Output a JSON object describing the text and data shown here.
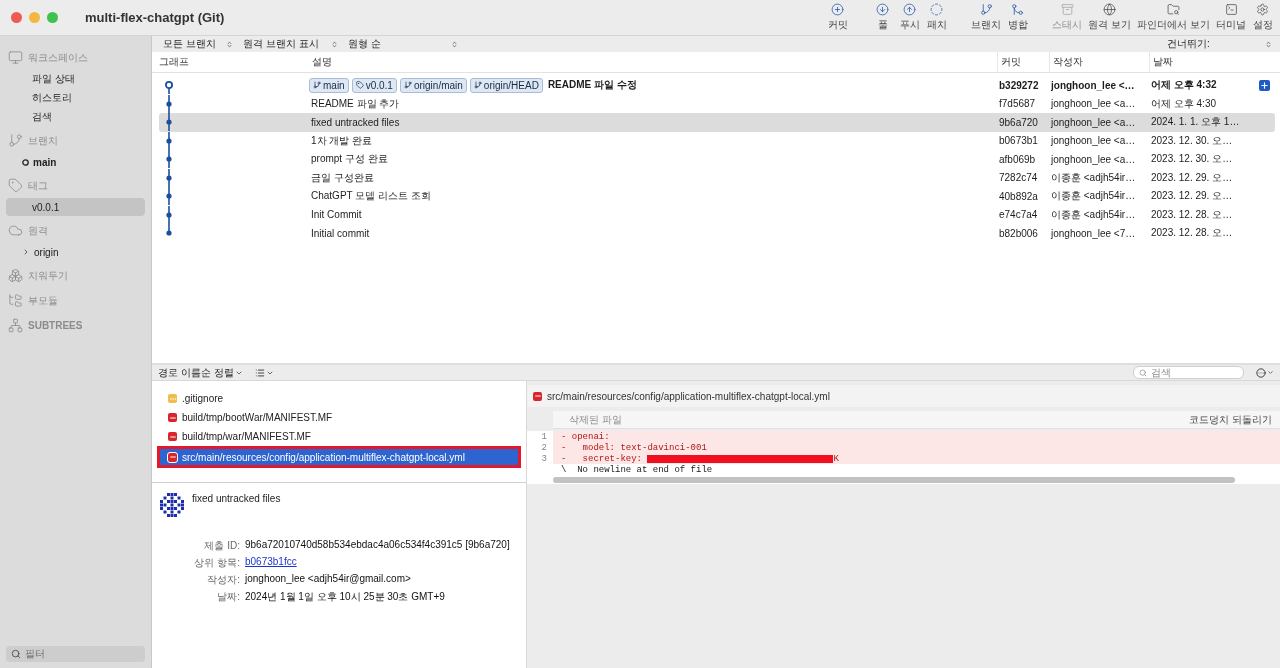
{
  "window": {
    "title": "multi-flex-chatgpt (Git)"
  },
  "toolbar": [
    {
      "label": "커밋",
      "kind": "commit",
      "disabled": false
    },
    {
      "label": "풀",
      "kind": "pull",
      "disabled": false
    },
    {
      "label": "푸시",
      "kind": "push",
      "disabled": false
    },
    {
      "label": "패치",
      "kind": "fetch",
      "disabled": false
    },
    {
      "label": "브랜치",
      "kind": "branch",
      "disabled": false
    },
    {
      "label": "병합",
      "kind": "merge",
      "disabled": false
    },
    {
      "label": "스태시",
      "kind": "stash",
      "disabled": true
    },
    {
      "label": "원격 보기",
      "kind": "remote",
      "disabled": false
    },
    {
      "label": "파인더에서 보기",
      "kind": "finder",
      "disabled": false
    },
    {
      "label": "터미널",
      "kind": "terminal",
      "disabled": false
    },
    {
      "label": "설정",
      "kind": "settings",
      "disabled": false
    }
  ],
  "sidebar": {
    "sections": [
      {
        "title": "워크스페이스",
        "kind": "workspace",
        "items": [
          {
            "label": "파일 상태",
            "selected": false
          },
          {
            "label": "히스토리",
            "selected": false
          },
          {
            "label": "검색",
            "selected": false
          }
        ]
      },
      {
        "title": "브랜치",
        "kind": "branches",
        "items": [
          {
            "label": "main",
            "selected": false,
            "current": true
          }
        ]
      },
      {
        "title": "태그",
        "kind": "tags",
        "items": [
          {
            "label": "v0.0.1",
            "selected": true
          }
        ]
      },
      {
        "title": "원격",
        "kind": "remotes",
        "items": [
          {
            "label": "origin",
            "selected": false,
            "expanded": false
          }
        ]
      },
      {
        "title": "치워두기",
        "kind": "stashes"
      },
      {
        "title": "부모듈",
        "kind": "submodules"
      },
      {
        "title": "SUBTREES",
        "kind": "subtrees"
      }
    ],
    "filter": {
      "placeholder": "필터"
    }
  },
  "history_filters": [
    "모든 브랜치",
    "원격 브랜치 표시",
    "원형 순"
  ],
  "jump_to": "건너뛰기:",
  "table": {
    "columns": [
      "그래프",
      "설명",
      "커밋",
      "작성자",
      "날짜"
    ],
    "rows": [
      {
        "refs": [
          {
            "label": "main",
            "kind": "branch"
          },
          {
            "label": "v0.0.1",
            "kind": "tag"
          },
          {
            "label": "origin/main",
            "kind": "branch"
          },
          {
            "label": "origin/HEAD",
            "kind": "branch"
          }
        ],
        "description": "README 파일 수정",
        "commit": "b329272",
        "author": "jonghoon_lee <…",
        "date": "어제 오후 4:32",
        "head": true,
        "selected": false
      },
      {
        "description": "README 파일 추가",
        "commit": "f7d5687",
        "author": "jonghoon_lee <a…",
        "date": "어제 오후 4:30",
        "head": false,
        "selected": false
      },
      {
        "description": "fixed untracked files",
        "commit": "9b6a720",
        "author": "jonghoon_lee <a…",
        "date": "2024. 1. 1. 오후 1…",
        "head": false,
        "selected": true
      },
      {
        "description": "1차 개발 완료",
        "commit": "b0673b1",
        "author": "jonghoon_lee <a…",
        "date": "2023. 12. 30. 오…",
        "head": false,
        "selected": false
      },
      {
        "description": "prompt 구성 완료",
        "commit": "afb069b",
        "author": "jonghoon_lee <a…",
        "date": "2023. 12. 30. 오…",
        "head": false,
        "selected": false
      },
      {
        "description": "금일 구성완료",
        "commit": "7282c74",
        "author": "이종훈 <adjh54ir…",
        "date": "2023. 12. 29. 오…",
        "head": false,
        "selected": false
      },
      {
        "description": "ChatGPT 모델 리스트 조회",
        "commit": "40b892a",
        "author": "이종훈 <adjh54ir…",
        "date": "2023. 12. 29. 오…",
        "head": false,
        "selected": false
      },
      {
        "description": "Init Commit",
        "commit": "e74c7a4",
        "author": "이종훈 <adjh54ir…",
        "date": "2023. 12. 28. 오…",
        "head": false,
        "selected": false
      },
      {
        "description": "Initial commit",
        "commit": "b82b006",
        "author": "jonghoon_lee <7…",
        "date": "2023. 12. 28. 오…",
        "head": false,
        "selected": false
      }
    ]
  },
  "files_bar": {
    "sort": "경로 이름순 정렬",
    "search_placeholder": "검색"
  },
  "files": [
    {
      "path": ".gitignore",
      "kind": "untracked",
      "selected": false,
      "highlighted": false
    },
    {
      "path": "build/tmp/bootWar/MANIFEST.MF",
      "kind": "deleted",
      "selected": false,
      "highlighted": false
    },
    {
      "path": "build/tmp/war/MANIFEST.MF",
      "kind": "deleted",
      "selected": false,
      "highlighted": false
    },
    {
      "path": "src/main/resources/config/application-multiflex-chatgpt-local.yml",
      "kind": "deleted",
      "selected": true,
      "highlighted": true
    }
  ],
  "commit_details": {
    "message": "fixed untracked files",
    "fields": [
      {
        "label": "제출 ID:",
        "value": "9b6a72010740d58b534ebdac4a06c534f4c391c5 [9b6a720]",
        "kind": "text"
      },
      {
        "label": "상위 항목:",
        "value": "b0673b1fcc",
        "kind": "link"
      },
      {
        "label": "작성자:",
        "value": "jonghoon_lee <adjh54ir@gmail.com>",
        "kind": "text"
      },
      {
        "label": "날짜:",
        "value": "2024년 1월 1일 오후 10시 25분 30초 GMT+9",
        "kind": "text"
      }
    ]
  },
  "diff": {
    "path": "src/main/resources/config/application-multiflex-chatgpt-local.yml",
    "hunk_title": "삭제된 파일",
    "revert_button": "코드덩치 되돌리기",
    "lines": [
      {
        "number": "1",
        "kind": "deleted",
        "text": "- openai:",
        "redacted": false
      },
      {
        "number": "2",
        "kind": "deleted",
        "text": "-   model: text-davinci-001",
        "redacted": false
      },
      {
        "number": "3",
        "kind": "deleted",
        "text": "-   secret-key: ",
        "redacted": true,
        "tail": "K"
      },
      {
        "kind": "note",
        "text": "\\  No newline at end of file",
        "redacted": false
      }
    ]
  }
}
